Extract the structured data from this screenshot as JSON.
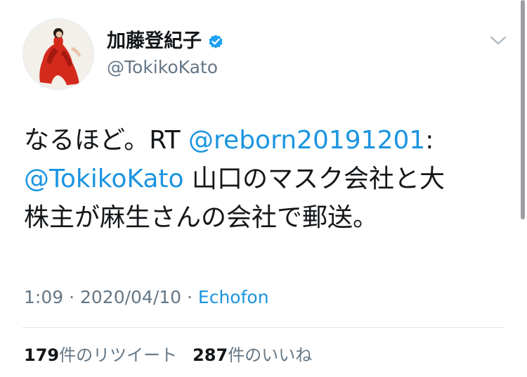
{
  "author": {
    "display_name": "加藤登紀子",
    "handle": "@TokikoKato",
    "verified": true,
    "avatar_icon": "profile-photo-woman-red-dress"
  },
  "tweet": {
    "line1_prefix": "なるほど。RT ",
    "line1_mention": "@reborn20191201",
    "line1_suffix": ":",
    "line2_mention": "@TokikoKato",
    "line2_text": " 山口のマスク会社と大",
    "line3_text": "株主が麻生さんの会社で郵送。"
  },
  "meta": {
    "time": "1:09",
    "separator1": " · ",
    "date": "2020/04/10",
    "separator2": " · ",
    "source": "Echofon"
  },
  "stats": {
    "retweets_count": "179",
    "retweets_label": "件のリツイート",
    "likes_count": "287",
    "likes_label": "件のいいね"
  },
  "colors": {
    "link": "#1b95e0",
    "secondary_text": "#657786",
    "primary_text": "#14171a",
    "verified": "#1da1f2"
  }
}
